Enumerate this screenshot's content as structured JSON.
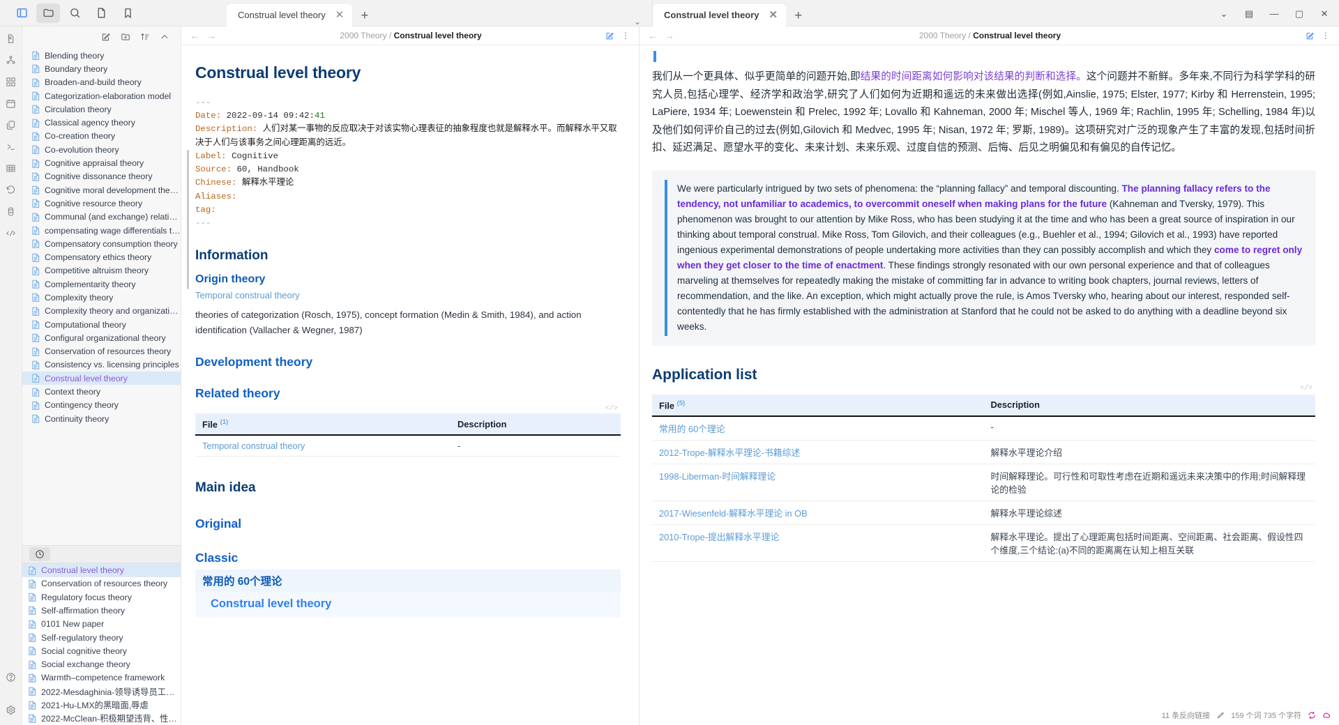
{
  "toolbar": {
    "left_icons": [
      {
        "name": "toggle-sidebar-icon",
        "label": "Toggle sidebar"
      },
      {
        "name": "folder-icon",
        "label": "Files"
      },
      {
        "name": "search-icon",
        "label": "Search"
      },
      {
        "name": "document-icon",
        "label": "Outline"
      },
      {
        "name": "bookmark-icon",
        "label": "Bookmarks"
      }
    ]
  },
  "dock": {
    "items": [
      {
        "name": "doc-search-icon",
        "label": "Doc search"
      },
      {
        "name": "graph-icon",
        "label": "Graph"
      },
      {
        "name": "blocks-icon",
        "label": "Blocks"
      },
      {
        "name": "calendar-icon",
        "label": "Daily note"
      },
      {
        "name": "copy-icon",
        "label": "Duplicate"
      },
      {
        "name": "terminal-icon",
        "label": "Console"
      },
      {
        "name": "table-icon",
        "label": "Table"
      },
      {
        "name": "history-icon",
        "label": "History"
      },
      {
        "name": "database-icon",
        "label": "Database"
      },
      {
        "name": "code-icon",
        "label": "Code"
      }
    ],
    "bottom": [
      {
        "name": "help-icon",
        "label": "Help"
      },
      {
        "name": "settings-icon",
        "label": "Settings"
      }
    ]
  },
  "file_panel": {
    "actions": [
      {
        "name": "new-doc-icon",
        "label": "New document"
      },
      {
        "name": "new-folder-icon",
        "label": "New folder"
      },
      {
        "name": "sort-icon",
        "label": "Sort"
      },
      {
        "name": "collapse-icon",
        "label": "Collapse all"
      }
    ],
    "items": [
      {
        "label": "Blending theory",
        "selected": false
      },
      {
        "label": "Boundary theory",
        "selected": false
      },
      {
        "label": "Broaden-and-build theory",
        "selected": false
      },
      {
        "label": "Categorization-elaboration model",
        "selected": false
      },
      {
        "label": "Circulation theory",
        "selected": false
      },
      {
        "label": "Classical agency theory",
        "selected": false
      },
      {
        "label": "Co-creation theory",
        "selected": false
      },
      {
        "label": "Co-evolution theory",
        "selected": false
      },
      {
        "label": "Cognitive appraisal theory",
        "selected": false
      },
      {
        "label": "Cognitive dissonance theory",
        "selected": false
      },
      {
        "label": "Cognitive moral development theory",
        "selected": false
      },
      {
        "label": "Cognitive resource theory",
        "selected": false
      },
      {
        "label": "Communal (and exchange) relationshi...",
        "selected": false
      },
      {
        "label": "compensating wage differentials theory",
        "selected": false
      },
      {
        "label": "Compensatory consumption theory",
        "selected": false
      },
      {
        "label": "Compensatory ethics theory",
        "selected": false
      },
      {
        "label": "Competitive altruism theory",
        "selected": false
      },
      {
        "label": "Complementarity theory",
        "selected": false
      },
      {
        "label": "Complexity theory",
        "selected": false
      },
      {
        "label": "Complexity theory and organizations",
        "selected": false
      },
      {
        "label": "Computational theory",
        "selected": false
      },
      {
        "label": "Configural organizational theory",
        "selected": false
      },
      {
        "label": "Conservation of resources theory",
        "selected": false
      },
      {
        "label": "Consistency vs. licensing principles",
        "selected": false
      },
      {
        "label": "Construal level theory",
        "selected": true
      },
      {
        "label": "Context theory",
        "selected": false
      },
      {
        "label": "Contingency theory",
        "selected": false
      },
      {
        "label": "Continuity theory",
        "selected": false
      }
    ],
    "recent_icon": "clock-icon",
    "recent": [
      {
        "label": "Construal level theory",
        "selected": true
      },
      {
        "label": "Conservation of resources theory",
        "selected": false
      },
      {
        "label": "Regulatory focus theory",
        "selected": false
      },
      {
        "label": "Self-affirmation theory",
        "selected": false
      },
      {
        "label": "0101 New paper",
        "selected": false
      },
      {
        "label": "Self-regulatory theory",
        "selected": false
      },
      {
        "label": "Social cognitive theory",
        "selected": false
      },
      {
        "label": "Social exchange theory",
        "selected": false
      },
      {
        "label": "Warmth–competence framework",
        "selected": false
      },
      {
        "label": "2022-Mesdaghinia-领导诱导员工非伦理...",
        "selected": false
      },
      {
        "label": "2021-Hu-LMX的黑暗面,辱虐",
        "selected": false
      },
      {
        "label": "2022-McClean-积极期望违背、性别、想...",
        "selected": false
      }
    ]
  },
  "center_pane": {
    "tab": {
      "label": "Construal level theory",
      "close": "✕"
    },
    "new_tab": "+",
    "breadcrumb": {
      "root": "2000 Theory",
      "sep": "/",
      "current": "Construal level theory"
    },
    "nav": {
      "back": "←",
      "forward": "→"
    },
    "edit_icon": "edit-icon",
    "more_icon": "more-vertical-icon",
    "title": "Construal level theory",
    "frontmatter": {
      "open": "---",
      "close": "---",
      "rows": [
        {
          "key": "Date:",
          "value": "2022-09-14 09:42:",
          "value2": "41",
          "type": "date"
        },
        {
          "key": "Description:",
          "value": "人们对某一事物的反应取决于对该实物心理表征的抽象程度也就是解释水平。而解释水平又取决于人们与该事务之间心理距离的远近。",
          "type": "cn"
        },
        {
          "key": "Label:",
          "value": "Cognitive",
          "type": "plain"
        },
        {
          "key": "Source:",
          "value": "60, Handbook",
          "type": "plain"
        },
        {
          "key": "Chinese:",
          "value": "解释水平理论",
          "type": "cn"
        },
        {
          "key": "Aliases:",
          "value": "",
          "type": "plain"
        },
        {
          "key": "tag:",
          "value": "",
          "type": "plain"
        }
      ]
    },
    "sections": {
      "information": "Information",
      "origin_theory": "Origin theory",
      "origin_link": "Temporal construal theory",
      "origin_body": "theories of categorization (Rosch, 1975), concept formation (Medin & Smith, 1984), and action identification (Vallacher & Wegner, 1987)",
      "development_theory": "Development theory",
      "related_theory": "Related theory",
      "main_idea": "Main idea",
      "original": "Original",
      "classic": "Classic"
    },
    "related_table": {
      "code_tag": "</>",
      "columns": [
        {
          "label": "File",
          "count": "(1)"
        },
        {
          "label": "Description",
          "count": ""
        }
      ],
      "rows": [
        {
          "file": "Temporal construal theory",
          "description": "-"
        }
      ]
    },
    "classic_block": {
      "heading": "常用的 60个理论",
      "sub_title": "Construal level theory"
    }
  },
  "right_pane": {
    "tab": {
      "label": "Construal level theory",
      "close": "✕"
    },
    "new_tab": "+",
    "breadcrumb": {
      "root": "2000 Theory",
      "sep": "/",
      "current": "Construal level theory"
    },
    "nav": {
      "back": "←",
      "forward": "→"
    },
    "edit_icon": "edit-icon",
    "more_icon": "more-vertical-icon",
    "chevron": "⌄",
    "window_controls": [
      {
        "name": "minimize-pane-icon",
        "glyph": "⌄"
      },
      {
        "name": "split-pane-icon",
        "glyph": "▤"
      },
      {
        "name": "minimize-window-button",
        "glyph": "—"
      },
      {
        "name": "maximize-window-button",
        "glyph": "▢"
      },
      {
        "name": "close-window-button",
        "glyph": "✕"
      }
    ],
    "paragraph_cn": {
      "part1": "我们从一个更具体、似乎更简单的问题开始,即",
      "emphasis": "结果的时间距离如何影响对该结果的判断和选择。",
      "part2": "这个问题并不新鲜。多年来,不同行为科学学科的研究人员,包括心理学、经济学和政治学,研究了人们如何为近期和遥远的未来做出选择(例如,Ainslie, 1975; Elster, 1977; Kirby 和 Herrenstein, 1995; LaPiere, 1934 年; Loewenstein 和 Prelec, 1992 年; Lovallo 和 Kahneman, 2000 年; Mischel 等人, 1969 年; Rachlin, 1995 年; Schelling, 1984 年)以及他们如何评价自己的过去(例如,Gilovich 和 Medvec, 1995 年; Nisan, 1972 年; 罗斯, 1989)。这项研究对广泛的现象产生了丰富的发现,包括时间折扣、延迟满足、愿望水平的变化、未来计划、未来乐观、过度自信的预测、后悔、后见之明偏见和有偏见的自传记忆。"
    },
    "quote": {
      "s1": "We were particularly intrigued by two sets of phenomena: the “planning fallacy” and temporal discounting. ",
      "b1": "The planning fallacy refers to the tendency, not unfamiliar to academics, to overcommit oneself when making plans for the future",
      "s2": " (Kahneman and Tversky, 1979). This phenomenon was brought to our attention by Mike Ross, who has been studying it at the time and who has been a great source of inspiration in our thinking about temporal construal. Mike Ross, Tom Gilovich, and their colleagues (e.g., Buehler et al., 1994; Gilovich et al., 1993) have reported ingenious experimental demonstrations of people undertaking more activities than they can possibly accomplish and which they ",
      "b2": "come to regret only when they get closer to the time of enactment",
      "s3": ". These findings strongly resonated with our own personal experience and that of colleagues marveling at themselves for repeatedly making the mistake of committing far in advance to writing book chapters, journal reviews, letters of recommendation, and the like. An exception, which might actually prove the rule, is Amos Tversky who, hearing about our interest, responded self-contentedly that he has firmly established with the administration at Stanford that he could not be asked to do anything with a deadline beyond six weeks."
    },
    "application_list": {
      "heading": "Application list",
      "code_tag": "</>",
      "columns": [
        {
          "label": "File",
          "count": "(5)"
        },
        {
          "label": "Description",
          "count": ""
        }
      ],
      "rows": [
        {
          "file": "常用的 60个理论",
          "description": "-"
        },
        {
          "file": "2012-Trope-解释水平理论-书籍综述",
          "description": "解释水平理论介绍"
        },
        {
          "file": "1998-Liberman-时间解释理论",
          "description": "时间解释理论。可行性和可取性考虑在近期和遥远未来决策中的作用;时间解释理论的检验"
        },
        {
          "file": "2017-Wiesenfeld-解释水平理论 in OB",
          "description": "解释水平理论综述"
        },
        {
          "file": "2010-Trope-提出解释水平理论",
          "description": "解释水平理论。提出了心理距离包括时间距离、空间距离、社会距离、假设性四个维度,三个结论:(a)不同的距离离在认知上相互关联"
        }
      ]
    },
    "statusbar": {
      "backlink": "11 条反向链接",
      "pencil_icon": "pencil-icon",
      "counts": "159 个词  735 个字符",
      "sync_icon": "sync-icon",
      "cloud_icon": "cloud-icon"
    }
  },
  "colors": {
    "accent": "#4285f4",
    "heading": "#0b3c73",
    "link": "#5b9bd5",
    "selected_bg": "#dbe8f7",
    "selected_text": "#8b5cd6",
    "quote_border": "#3b8ee0",
    "pink": "#e5007f"
  }
}
